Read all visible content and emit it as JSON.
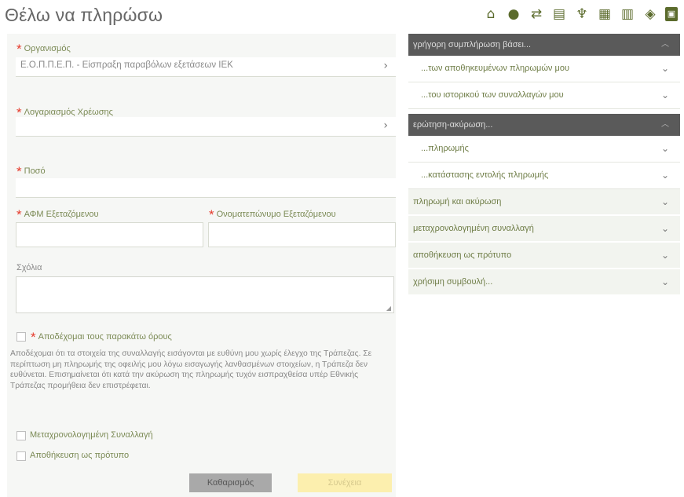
{
  "page_title": "Θέλω να πληρώσω",
  "top_icons": [
    "home-icon",
    "info-icon",
    "transfer-icon",
    "cards-icon",
    "trophy-icon",
    "chart-icon",
    "stats-icon",
    "piggy-bank-icon",
    "document-icon"
  ],
  "form": {
    "organization": {
      "label": "Οργανισμός",
      "value": "Ε.Ο.Π.Π.Ε.Π. - Είσπραξη παραβόλων εξετάσεων ΙΕΚ"
    },
    "debit_account": {
      "label": "Λογαριασμός Χρέωσης",
      "value": ""
    },
    "amount": {
      "label": "Ποσό",
      "value": ""
    },
    "tax_id": {
      "label": "ΑΦΜ Εξεταζόμενου",
      "value": ""
    },
    "full_name": {
      "label": "Ονοματεπώνυμο Εξεταζόμενου",
      "value": ""
    },
    "comments": {
      "label": "Σχόλια",
      "value": ""
    },
    "accept_terms_label": "Αποδέχομαι τους παρακάτω όρους",
    "terms_text": "Αποδέχομαι ότι τα στοιχεία της συναλλαγής εισάγονται με ευθύνη μου χωρίς έλεγχο της Τράπεζας. Σε περίπτωση μη πληρωμής της οφειλής μου λόγω εισαγωγής λανθασμένων στοιχείων, η Τράπεζα δεν ευθύνεται. Επισημαίνεται ότι κατά την ακύρωση της πληρωμής τυχόν εισπραχθείσα υπέρ Εθνικής Τράπεζας προμήθεια δεν επιστρέφεται.",
    "scheduled_label": "Μεταχρονολογημένη Συναλλαγή",
    "save_template_label": "Αποθήκευση ως πρότυπο",
    "back_button": "Καθαρισμός",
    "continue_button": "Συνέχεια"
  },
  "sidebar": {
    "section1": {
      "title": "γρήγορη συμπλήρωση βάσει...",
      "items": [
        "...των αποθηκευμένων πληρωμών μου",
        "...του ιστορικού των συναλλαγών μου"
      ]
    },
    "section2": {
      "title": "ερώτηση-ακύρωση...",
      "items": [
        "...πληρωμής",
        "...κατάστασης εντολής πληρωμής"
      ]
    },
    "links": [
      "πληρωμή και ακύρωση",
      "μεταχρονολογημένη συναλλαγή",
      "αποθήκευση ως πρότυπο",
      "χρήσιμη συμβουλή..."
    ]
  }
}
